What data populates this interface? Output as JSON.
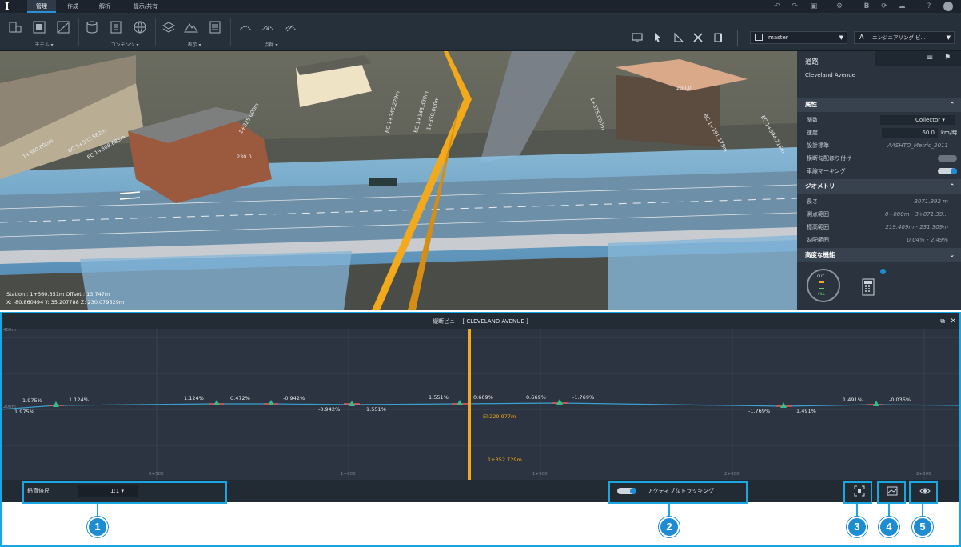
{
  "nav": {
    "tabs": [
      "管理",
      "作成",
      "解析",
      "提示/共有"
    ]
  },
  "ribbon": {
    "groups": [
      "モデル",
      "コンテンツ",
      "表示",
      "点群"
    ],
    "branch": "master",
    "engineering": "エンジニアリング ビ..."
  },
  "viewport": {
    "stations": [
      "1+300.000m",
      "BC 1+302.562m",
      "EC 1+308.683m",
      "1+325.000m",
      "BC 1+346.229m",
      "EC 1+348.339m",
      "1+350.000m",
      "1+375.000m",
      "BC 1+391.175m",
      "EC 1+394.216m"
    ],
    "elev_labels": [
      "230.0",
      "230.0"
    ],
    "status_line1": "Station : 1+360.351m Offset : 13.747m",
    "status_line2": "X: -80.860494 Y: 35.207788 Z: 230.079529m"
  },
  "panel": {
    "title": "道路",
    "subtitle": "Cleveland Avenue",
    "attributes_header": "属性",
    "attributes": [
      {
        "label": "関数",
        "value": "Collector"
      },
      {
        "label": "速度",
        "value": "60.0",
        "unit": "km/時"
      },
      {
        "label": "設計標準",
        "value": "AASHTO_Metric_2011"
      },
      {
        "label": "横断勾配ほり付け",
        "value": ""
      },
      {
        "label": "車線マーキング",
        "value": ""
      }
    ],
    "geometry_header": "ジオメトリ",
    "geometry": [
      {
        "label": "長さ",
        "value": "3071.392  m"
      },
      {
        "label": "測点範囲",
        "value": "0+000m - 3+071.39..."
      },
      {
        "label": "標高範囲",
        "value": "219.409m - 231.309m"
      },
      {
        "label": "勾配範囲",
        "value": "0.04% - 2.49%"
      }
    ],
    "advanced_header": "高度な機能",
    "cut": "CUT",
    "fill": "FILL"
  },
  "profile": {
    "title": "縦断ビュー [ CLEVELAND AVENUE ]",
    "y_top": "400m",
    "y_mid": "200m",
    "x_ticks": [
      "0+500",
      "1+000",
      "1+500",
      "2+000",
      "2+500"
    ],
    "elev_marker": "El:229.977m",
    "station_marker": "1+352.729m",
    "grades_above": [
      "1.975%",
      "1.124%",
      "1.124%",
      "0.472%",
      "-0.942%",
      "1.551%",
      "0.669%",
      "0.669%",
      "-1.769%",
      "1.491%",
      "-0.035%"
    ],
    "grades_below": [
      "1.975%",
      "-0.942%",
      "1.551%",
      "-1.769%",
      "1.491%"
    ],
    "vertical_scale_label": "鉛直倍尺",
    "vertical_scale_value": "1:1",
    "tracking_label": "アクティブなトラッキング"
  },
  "callouts": [
    "1",
    "2",
    "3",
    "4",
    "5"
  ],
  "colors": {
    "accent": "#1aa6e0",
    "profile_line": "#3aa0d0",
    "marker": "#f2a91c"
  }
}
